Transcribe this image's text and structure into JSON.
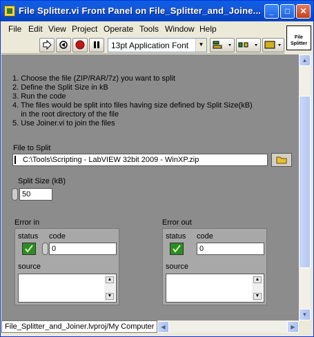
{
  "window": {
    "title": "File Splitter.vi Front Panel on File_Splitter_and_Joiner.lvproj/My Computer",
    "title_shown": "File Splitter.vi Front Panel on File_Splitter_and_Joine..."
  },
  "menubar": {
    "items": [
      "File",
      "Edit",
      "View",
      "Project",
      "Operate",
      "Tools",
      "Window",
      "Help"
    ]
  },
  "toolbar": {
    "font_selector": "13pt Application Font"
  },
  "vi_icon": {
    "line1": "File",
    "line2": "Splitter"
  },
  "instructions": [
    "1. Choose the file (ZIP/RAR/7z) you want to split",
    "2. Define the Split Size in kB",
    "3. Run the code",
    "4. The files would be split into files having size defined by Split Size(kB)",
    "    in the root directory of the file",
    "5. Use Joiner.vi to join the files"
  ],
  "file_to_split": {
    "label": "File to Split",
    "value": "C:\\Tools\\Scripting - LabVIEW 32bit 2009 - WinXP.zip"
  },
  "split_size": {
    "label": "Split Size (kB)",
    "value": "50"
  },
  "error_in": {
    "label": "Error in",
    "status_label": "status",
    "code_label": "code",
    "code_value": "0",
    "source_label": "source"
  },
  "error_out": {
    "label": "Error out",
    "status_label": "status",
    "code_label": "code",
    "code_value": "0",
    "source_label": "source"
  },
  "statusbar": {
    "text": "File_Splitter_and_Joiner.lvproj/My Computer"
  },
  "colors": {
    "title_bar": "#0a5fe6",
    "panel_bg": "#8c8c8c",
    "status_led": "#2e8b23"
  }
}
